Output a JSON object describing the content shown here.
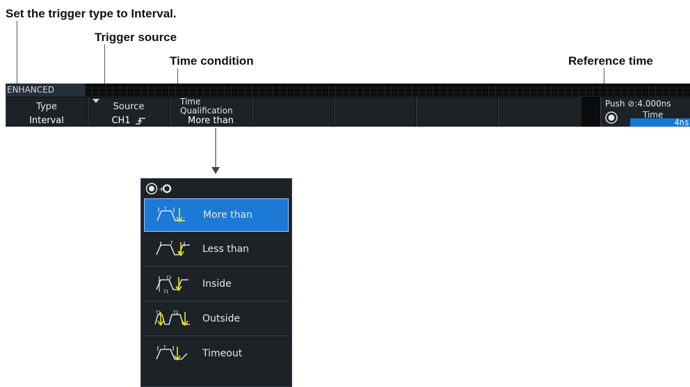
{
  "callouts": {
    "trigger_type": "Set the trigger type to Interval.",
    "trigger_source": "Trigger source",
    "time_condition": "Time condition",
    "reference_time": "Reference time"
  },
  "menubar": {
    "tab_label": "ENHANCED",
    "softkeys": [
      {
        "label": "Type",
        "value": "Interval"
      },
      {
        "label": "Source",
        "value": "CH1"
      },
      {
        "label": "Time\nQualification",
        "value": "More than"
      }
    ],
    "reference": {
      "push_text": "Push ⊘:4.000ns",
      "label": "Time",
      "value": "4ns"
    }
  },
  "popup": {
    "options": [
      {
        "label": "More than",
        "selected": true
      },
      {
        "label": "Less than",
        "selected": false
      },
      {
        "label": "Inside",
        "selected": false
      },
      {
        "label": "Outside",
        "selected": false
      },
      {
        "label": "Timeout",
        "selected": false
      }
    ]
  },
  "colors": {
    "selected_bg": "#1c79d6",
    "panel_bg": "#1d2227",
    "arrow_yellow": "#f2e600",
    "input_bg": "#1577d4"
  }
}
